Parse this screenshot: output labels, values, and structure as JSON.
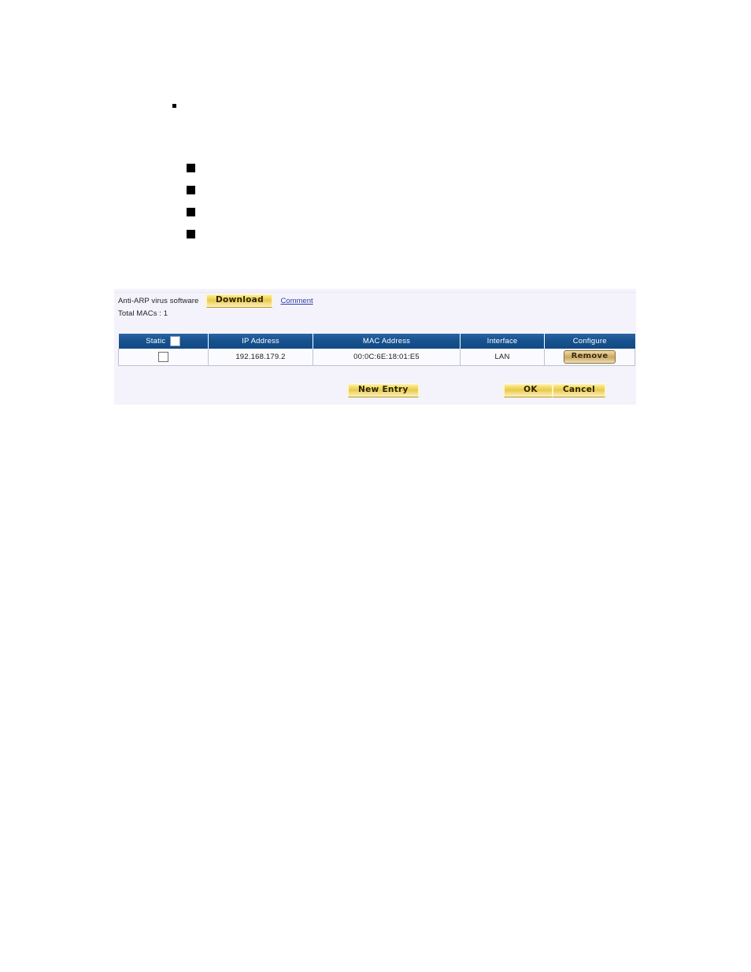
{
  "bullets": {
    "small_dot": "",
    "items": [
      "",
      "",
      "",
      ""
    ]
  },
  "panel": {
    "anti_arp_label": "Anti-ARP virus software",
    "download_button": "Download",
    "comment_link": "Comment",
    "total_macs_label": "Total MACs : 1",
    "table": {
      "columns": [
        "Static",
        "IP Address",
        "MAC Address",
        "Interface",
        "Configure"
      ],
      "header_static_checkbox_checked": false,
      "rows": [
        {
          "static_checked": false,
          "ip_address": "192.168.179.2",
          "mac_address": "00:0C:6E:18:01:E5",
          "interface": "LAN",
          "configure_button": "Remove"
        }
      ]
    },
    "footer": {
      "new_entry": "New Entry",
      "ok": "OK",
      "cancel": "Cancel"
    }
  },
  "colors": {
    "header_blue": "#17528f",
    "panel_bg": "#f4f3fc",
    "gold_button": "#e8c94a",
    "remove_button": "#c9a866",
    "link_blue": "#2b3fa8"
  }
}
